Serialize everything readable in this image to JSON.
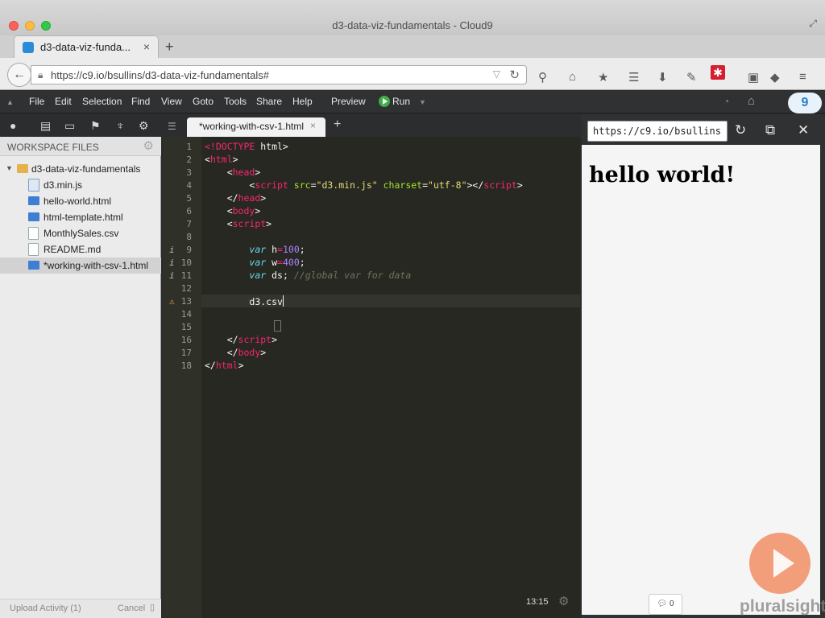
{
  "window": {
    "title": "d3-data-viz-fundamentals - Cloud9"
  },
  "browser": {
    "tab_title": "d3-data-viz-funda...",
    "url": "https://c9.io/bsullins/d3-data-viz-fundamentals#"
  },
  "menu": {
    "items": [
      "File",
      "Edit",
      "Selection",
      "Find",
      "View",
      "Goto",
      "Tools",
      "Share",
      "Help"
    ],
    "preview": "Preview",
    "run": "Run",
    "badge": "9"
  },
  "editor_tab": {
    "title": "*working-with-csv-1.html"
  },
  "sidebar": {
    "title": "WORKSPACE FILES",
    "folder": "d3-data-viz-fundamentals",
    "files": [
      {
        "name": "d3.min.js",
        "type": "js"
      },
      {
        "name": "hello-world.html",
        "type": "html"
      },
      {
        "name": "html-template.html",
        "type": "html"
      },
      {
        "name": "MonthlySales.csv",
        "type": "file"
      },
      {
        "name": "README.md",
        "type": "file"
      },
      {
        "name": "*working-with-csv-1.html",
        "type": "html"
      }
    ],
    "upload": "Upload Activity (1)",
    "cancel": "Cancel"
  },
  "code": {
    "line_numbers": [
      "1",
      "2",
      "3",
      "4",
      "5",
      "6",
      "7",
      "8",
      "9",
      "10",
      "11",
      "12",
      "13",
      "14",
      "15",
      "16",
      "17",
      "18"
    ],
    "lines": {
      "l9_kw": "var",
      "l9_name": "h",
      "l9_op": "=",
      "l9_num": "100",
      "l9_end": ";",
      "l10_kw": "var",
      "l10_name": "w",
      "l10_op": "=",
      "l10_num": "400",
      "l10_end": ";",
      "l11_kw": "var",
      "l11_name": "ds",
      "l11_end": ";",
      "l11_comment": "//global var for data",
      "l13": "d3.csv"
    }
  },
  "status": {
    "position": "13:15"
  },
  "preview": {
    "url": "https://c9.io/bsullins",
    "heading": "hello world!",
    "comment_count": "0",
    "watermark": "pluralsight"
  }
}
